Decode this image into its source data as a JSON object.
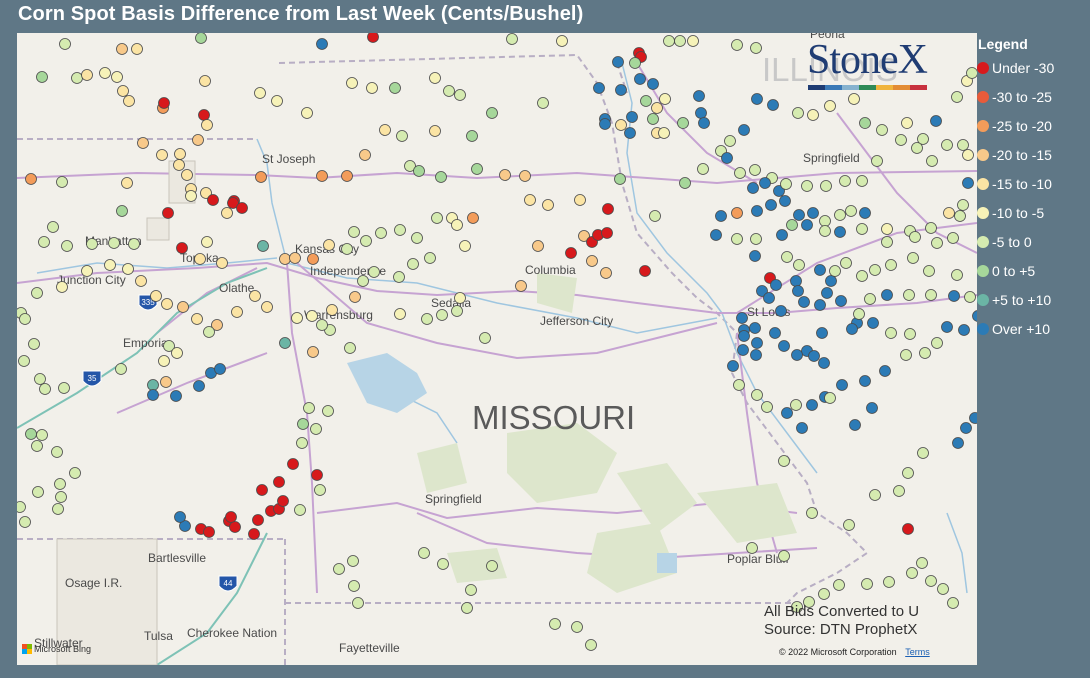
{
  "title": "Corn Spot Basis Difference from Last Week (Cents/Bushel)",
  "legend": {
    "title": "Legend",
    "items": [
      {
        "label": "Under -30",
        "color": "#d7191c"
      },
      {
        "label": "-30 to -25",
        "color": "#e85b3a"
      },
      {
        "label": "-25 to -20",
        "color": "#f39c5a"
      },
      {
        "label": "-20 to -15",
        "color": "#f8c98a"
      },
      {
        "label": "-15 to -10",
        "color": "#fbe4a4"
      },
      {
        "label": "-10 to -5",
        "color": "#f6f2b8"
      },
      {
        "label": "-5 to 0",
        "color": "#d5ebb0"
      },
      {
        "label": "0 to +5",
        "color": "#a6d79a"
      },
      {
        "label": "+5 to +10",
        "color": "#6bb5a5"
      },
      {
        "label": "Over +10",
        "color": "#2c7bb6"
      }
    ]
  },
  "brand": {
    "name": "StoneX",
    "bar_colors": [
      "#1f3c73",
      "#3b79b6",
      "#86b2cf",
      "#2e8a57",
      "#f0b43c",
      "#e38c34",
      "#c8313e"
    ]
  },
  "map": {
    "state_label": "MISSOURI",
    "faded_state_label": "ILLINOIS",
    "places": [
      {
        "name": "St Joseph"
      },
      {
        "name": "Manhattan"
      },
      {
        "name": "Topeka"
      },
      {
        "name": "Junction City"
      },
      {
        "name": "Kansas City"
      },
      {
        "name": "Independence"
      },
      {
        "name": "Olathe"
      },
      {
        "name": "Emporia"
      },
      {
        "name": "Warrensburg"
      },
      {
        "name": "Sedalia"
      },
      {
        "name": "Columbia"
      },
      {
        "name": "Jefferson City"
      },
      {
        "name": "St Louis"
      },
      {
        "name": "Springfield"
      },
      {
        "name": "Springfield"
      },
      {
        "name": "Peoria"
      },
      {
        "name": "Bartlesville"
      },
      {
        "name": "Osage I.R."
      },
      {
        "name": "Poplar Bluff"
      },
      {
        "name": "Tulsa"
      },
      {
        "name": "Cherokee Nation"
      },
      {
        "name": "Fayetteville"
      },
      {
        "name": "Stillwater"
      }
    ],
    "shields": [
      {
        "label": "335"
      },
      {
        "label": "35"
      },
      {
        "label": "44"
      }
    ]
  },
  "source": {
    "line1": "All Bids Converted to U",
    "line2": "Source: DTN ProphetX"
  },
  "copyright": "© 2022 Microsoft Corporation",
  "terms": "Terms",
  "bing": "Microsoft Bing"
}
